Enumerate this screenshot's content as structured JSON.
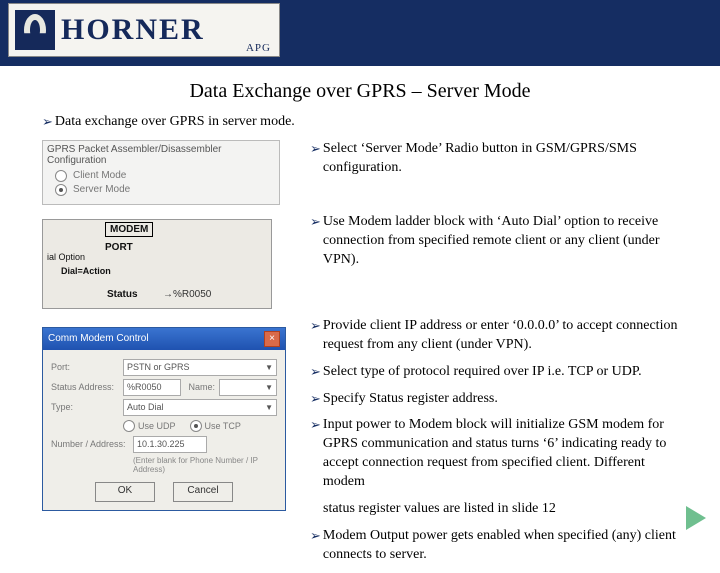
{
  "logo": {
    "name": "HORNER",
    "sub": "APG"
  },
  "title": "Data Exchange over GPRS – Server Mode",
  "intro": "Data exchange over GPRS in server mode.",
  "gprs": {
    "title": "GPRS Packet Assembler/Disassembler Configuration",
    "opt_client": "Client Mode",
    "opt_server": "Server Mode"
  },
  "modem": {
    "hdr": "MODEM",
    "lbl1": "ial Option",
    "lbl2": "PORT",
    "lbl3": "Dial=Action",
    "status_lbl": "Status",
    "status_val": "→%R0050"
  },
  "comm": {
    "title": "Comm Modem Control",
    "port_lbl": "Port:",
    "port_val": "PSTN or GPRS",
    "status_lbl": "Status Address:",
    "status_val": "%R0050",
    "name_lbl": "Name:",
    "name_val": "",
    "type_lbl": "Type:",
    "type_val": "Auto Dial",
    "proto_udp": "Use UDP",
    "proto_tcp": "Use TCP",
    "num_lbl": "Number / Address:",
    "num_val": "10.1.30.225",
    "hint": "(Enter blank for Phone Number / IP Address)",
    "ok": "OK",
    "cancel": "Cancel"
  },
  "bullets": {
    "b1": "Select ‘Server Mode’ Radio button in GSM/GPRS/SMS configuration.",
    "b2": " Use Modem ladder block with ‘Auto Dial’ option to receive connection from specified remote client or any client (under VPN).",
    "b3": "Provide client IP address or enter ‘0.0.0.0’ to accept connection request from any client (under VPN).",
    "b4": "Select type of protocol required over IP i.e. TCP or UDP.",
    "b5": "Specify Status register address.",
    "b6": "Input power to Modem block will initialize GSM modem for GPRS communication and status turns ‘6’ indicating ready to accept connection request from specified client. Different modem",
    "b6b": "status register values are listed in slide 12",
    "b7": "Modem Output power gets enabled when specified (any) client connects to server."
  }
}
